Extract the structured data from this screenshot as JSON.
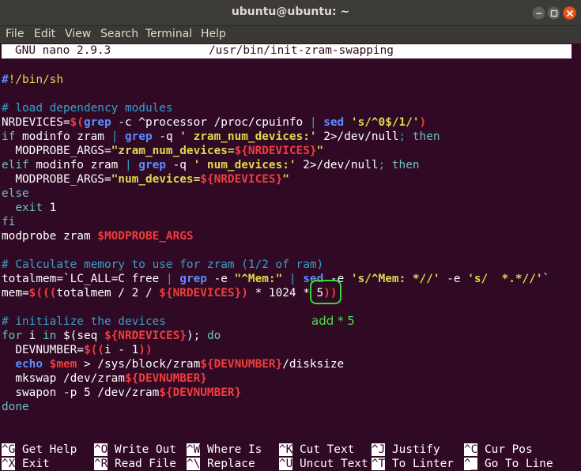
{
  "window": {
    "title": "ubuntu@ubuntu: ~"
  },
  "menubar": {
    "items": [
      "File",
      "Edit",
      "View",
      "Search",
      "Terminal",
      "Help"
    ]
  },
  "nano": {
    "version": "GNU nano 2.9.3",
    "filename": "/usr/bin/init-zram-swapping"
  },
  "annotation": {
    "text": "add * 5"
  },
  "help": {
    "row1": [
      {
        "key": "^G",
        "label": "Get Help"
      },
      {
        "key": "^O",
        "label": "Write Out"
      },
      {
        "key": "^W",
        "label": "Where Is"
      },
      {
        "key": "^K",
        "label": "Cut Text"
      },
      {
        "key": "^J",
        "label": "Justify"
      },
      {
        "key": "^C",
        "label": "Cur Pos"
      }
    ],
    "row2": [
      {
        "key": "^X",
        "label": "Exit"
      },
      {
        "key": "^R",
        "label": "Read File"
      },
      {
        "key": "^\\",
        "label": "Replace"
      },
      {
        "key": "^U",
        "label": "Uncut Text"
      },
      {
        "key": "^T",
        "label": "To Linter"
      },
      {
        "key": "^_",
        "label": "Go To Line"
      }
    ]
  },
  "script_lines": [
    [
      [
        "dir",
        "#"
      ],
      [
        "str",
        "!/bin/sh"
      ]
    ],
    [],
    [
      [
        "c",
        "# load dependency modules"
      ]
    ],
    [
      [
        "wh",
        "NRDEVICES="
      ],
      [
        "varb",
        "$("
      ],
      [
        "bc",
        "grep"
      ],
      [
        "wh",
        " -c ^processor /proc/cpuinfo "
      ],
      [
        "c",
        "|"
      ],
      [
        "wh",
        " "
      ],
      [
        "bc",
        "sed"
      ],
      [
        "wh",
        " "
      ],
      [
        "strb",
        "'s/^0$/1/'"
      ],
      [
        "varb",
        ")"
      ]
    ],
    [
      [
        "kw",
        "if"
      ],
      [
        "wh",
        " modinfo zram "
      ],
      [
        "c",
        "|"
      ],
      [
        "wh",
        " "
      ],
      [
        "bc",
        "grep"
      ],
      [
        "wh",
        " -q "
      ],
      [
        "strb",
        "' zram_num_devices:'"
      ],
      [
        "wh",
        " 2>/dev/null"
      ],
      [
        "c",
        ";"
      ],
      [
        "wh",
        " "
      ],
      [
        "kw",
        "then"
      ]
    ],
    [
      [
        "wh",
        "  MODPROBE_ARGS="
      ],
      [
        "strb",
        "\"zram_num_devices="
      ],
      [
        "varb",
        "${NRDEVICES}"
      ],
      [
        "strb",
        "\""
      ]
    ],
    [
      [
        "kw",
        "elif"
      ],
      [
        "wh",
        " modinfo zram "
      ],
      [
        "c",
        "|"
      ],
      [
        "wh",
        " "
      ],
      [
        "bc",
        "grep"
      ],
      [
        "wh",
        " -q "
      ],
      [
        "strb",
        "' num_devices:'"
      ],
      [
        "wh",
        " 2>/dev/null"
      ],
      [
        "c",
        ";"
      ],
      [
        "wh",
        " "
      ],
      [
        "kw",
        "then"
      ]
    ],
    [
      [
        "wh",
        "  MODPROBE_ARGS="
      ],
      [
        "strb",
        "\"num_devices="
      ],
      [
        "varb",
        "${NRDEVICES}"
      ],
      [
        "strb",
        "\""
      ]
    ],
    [
      [
        "kw",
        "else"
      ]
    ],
    [
      [
        "wh",
        "  "
      ],
      [
        "kw",
        "exit"
      ],
      [
        "wh",
        " 1"
      ]
    ],
    [
      [
        "kw",
        "fi"
      ]
    ],
    [
      [
        "wh",
        "modprobe zram "
      ],
      [
        "varb",
        "$MODPROBE_ARGS"
      ]
    ],
    [],
    [
      [
        "c",
        "# Calculate memory to use for zram (1/2 of ram)"
      ]
    ],
    [
      [
        "wh",
        "totalmem=`LC_ALL=C free "
      ],
      [
        "c",
        "|"
      ],
      [
        "wh",
        " "
      ],
      [
        "bc",
        "grep"
      ],
      [
        "wh",
        " -e "
      ],
      [
        "strb",
        "\"^Mem:\""
      ],
      [
        "wh",
        " "
      ],
      [
        "c",
        "|"
      ],
      [
        "wh",
        " "
      ],
      [
        "bc",
        "sed"
      ],
      [
        "wh",
        " -e "
      ],
      [
        "strb",
        "'s/^Mem: *//'"
      ],
      [
        "wh",
        " -e "
      ],
      [
        "strb",
        "'s/  *.*//'"
      ],
      [
        "wh",
        "`"
      ]
    ],
    [
      [
        "wh",
        "mem="
      ],
      [
        "varb",
        "$((("
      ],
      [
        "wh",
        "totalmem / 2 / "
      ],
      [
        "varb",
        "${NRDEVICES}"
      ],
      [
        "varb",
        ")"
      ],
      [
        "wh",
        " * 1024 * 5"
      ],
      [
        "varb",
        "))"
      ]
    ],
    [],
    [
      [
        "c",
        "# initialize the devices"
      ]
    ],
    [
      [
        "kw",
        "for"
      ],
      [
        "wh",
        " i "
      ],
      [
        "kw",
        "in"
      ],
      [
        "wh",
        " $(seq "
      ],
      [
        "varb",
        "${NRDEVICES}"
      ],
      [
        "wh",
        "); "
      ],
      [
        "kw",
        "do"
      ]
    ],
    [
      [
        "wh",
        "  DEVNUMBER="
      ],
      [
        "varb",
        "$(("
      ],
      [
        "wh",
        "i - 1"
      ],
      [
        "varb",
        "))"
      ]
    ],
    [
      [
        "wh",
        "  "
      ],
      [
        "bc",
        "echo"
      ],
      [
        "wh",
        " "
      ],
      [
        "varb",
        "$mem"
      ],
      [
        "wh",
        " > /sys/block/zram"
      ],
      [
        "varb",
        "${DEVNUMBER}"
      ],
      [
        "wh",
        "/disksize"
      ]
    ],
    [
      [
        "wh",
        "  mkswap /dev/zram"
      ],
      [
        "varb",
        "${DEVNUMBER}"
      ]
    ],
    [
      [
        "wh",
        "  swapon -p 5 /dev/zram"
      ],
      [
        "varb",
        "${DEVNUMBER}"
      ]
    ],
    [
      [
        "kw",
        "done"
      ]
    ]
  ]
}
